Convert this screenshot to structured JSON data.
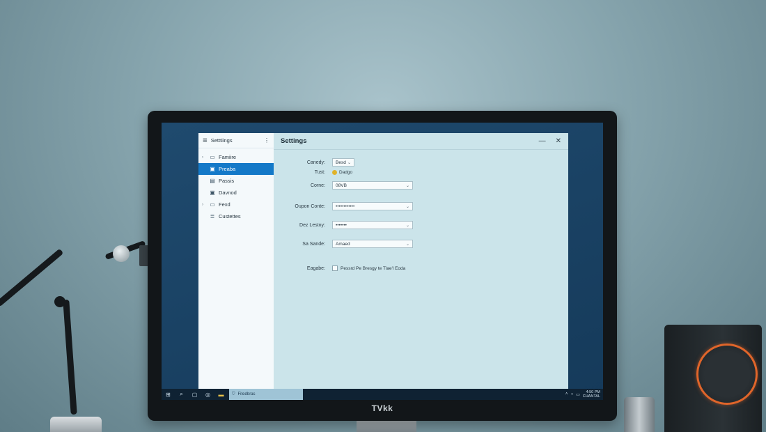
{
  "brand": "TVkk",
  "sidebar": {
    "title": "Setttiings",
    "items": [
      {
        "label": "Famiire",
        "icon": "folder-icon",
        "expandable": true,
        "active": false
      },
      {
        "label": "Preaba",
        "icon": "image-icon",
        "expandable": false,
        "active": true
      },
      {
        "label": "Passis",
        "icon": "document-icon",
        "expandable": false,
        "active": false
      },
      {
        "label": "Davnod",
        "icon": "image-icon",
        "expandable": false,
        "active": false
      },
      {
        "label": "Fexd",
        "icon": "folder-icon",
        "expandable": true,
        "active": false
      },
      {
        "label": "Custettes",
        "icon": "list-icon",
        "expandable": false,
        "active": false
      }
    ]
  },
  "window": {
    "title": "Settings",
    "minimize": "—",
    "close": "✕"
  },
  "form": {
    "category": {
      "label": "Canedy:",
      "value": "Besd"
    },
    "font": {
      "label": "Tust:",
      "value": "Dadgo"
    },
    "color": {
      "label": "Corne:",
      "value": "08VB"
    },
    "option1": {
      "label": "Oupon Conte:",
      "value": "••••••••••••"
    },
    "option2": {
      "label": "Dez Lestny:",
      "value": "•••••••"
    },
    "option3": {
      "label": "Sa Sande:",
      "value": "Amaed"
    },
    "checkbox": {
      "label": "Eagabe:",
      "text": "Pessrd Pe Bresgy te Tlae'l Eoda",
      "checked": false
    }
  },
  "taskbar": {
    "app_label": "Fitedbras",
    "clock_time": "4:50 PM",
    "clock_date": "CHANTAL"
  },
  "colors": {
    "accent": "#1479c8",
    "window_bg": "#cbe4ea",
    "speaker_ring": "#e0652a"
  }
}
